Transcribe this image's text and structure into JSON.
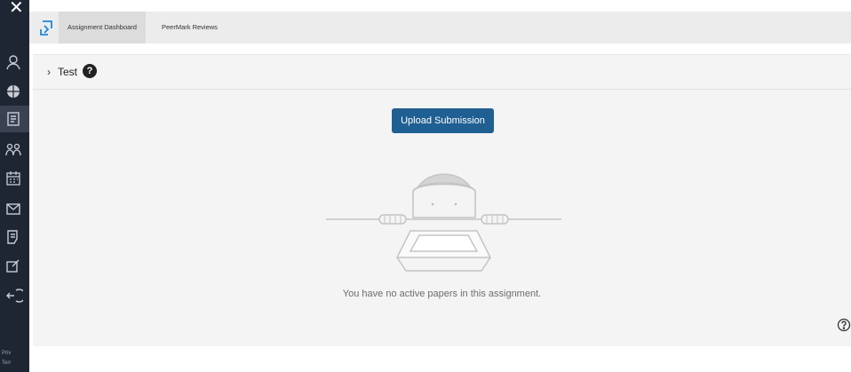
{
  "tabs": {
    "dashboard": "Assignment Dashboard",
    "peermark": "PeerMark Reviews"
  },
  "assignment": {
    "title": "Test",
    "help_glyph": "?"
  },
  "actions": {
    "upload": "Upload Submission"
  },
  "empty_state": {
    "message": "You have no active papers in this assignment."
  },
  "sidebar": {
    "close_glyph": "✕",
    "footer_1": "Priv",
    "footer_2": "Terr",
    "icons": [
      "user-icon",
      "globe-icon",
      "assignments-icon",
      "groups-icon",
      "calendar-icon",
      "inbox-icon",
      "grades-icon",
      "edit-icon",
      "logout-icon"
    ]
  },
  "colors": {
    "sidebar_bg": "#1f2633",
    "primary_button": "#1f5f92",
    "panel_bg": "#f4f4f4",
    "logo_blue": "#1e88d6"
  }
}
